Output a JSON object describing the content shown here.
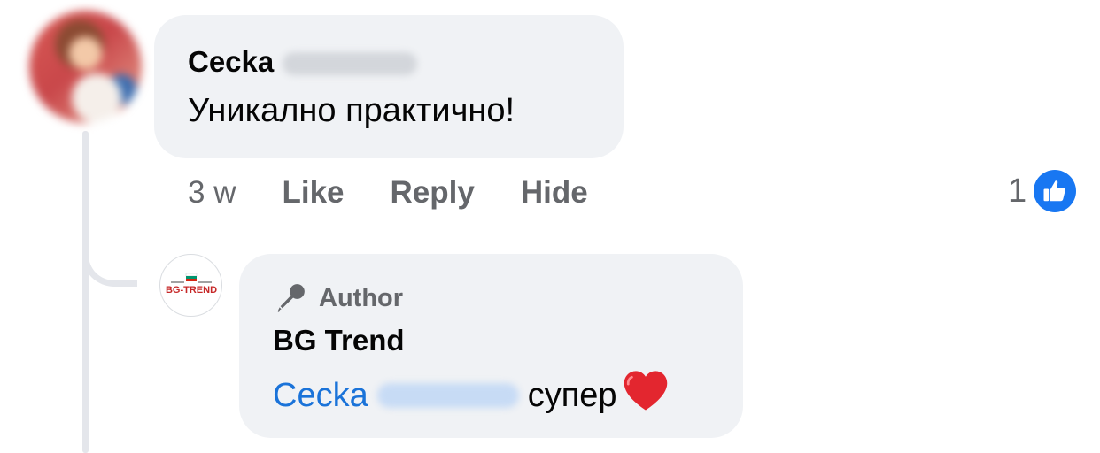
{
  "comment": {
    "author_first": "Cecka",
    "text": "Уникално практично!",
    "time": "3 w",
    "actions": {
      "like": "Like",
      "reply": "Reply",
      "hide": "Hide"
    },
    "reaction_count": "1"
  },
  "reply": {
    "badge": "Author",
    "author": "BG Trend",
    "mention": "Cecka",
    "text": "супер",
    "emoji": "red-heart",
    "page_logo_text": "BG-TREND"
  },
  "colors": {
    "bubble": "#f0f2f5",
    "secondary_text": "#65676b",
    "link": "#1a73d9",
    "like_blue": "#1877f2",
    "thread_line": "#e4e6eb"
  }
}
